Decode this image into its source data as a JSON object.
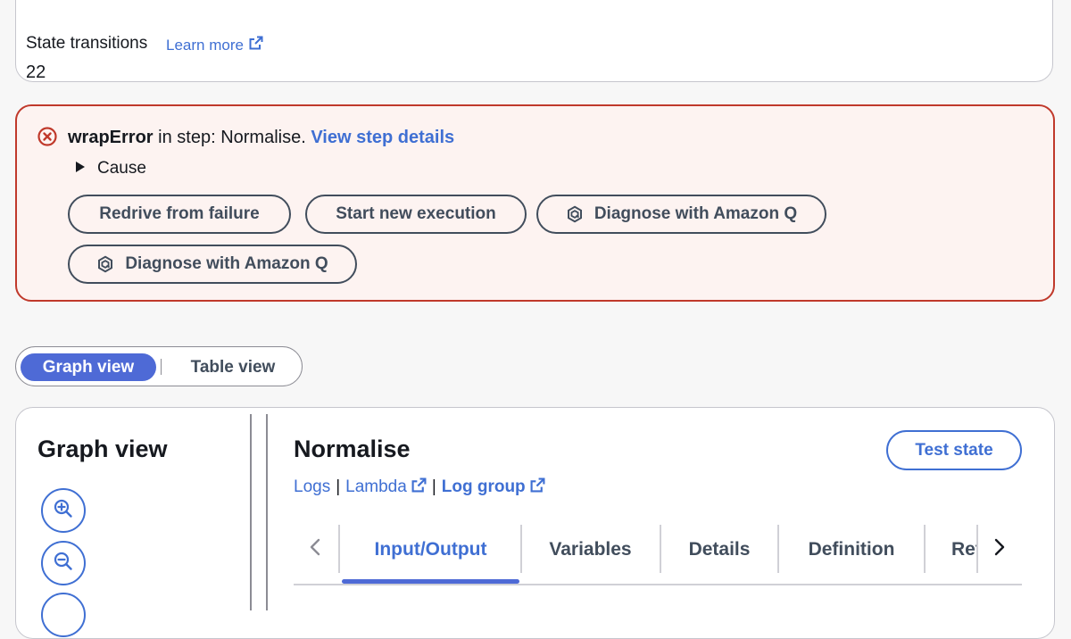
{
  "summary": {
    "state_transitions_label": "State transitions",
    "learn_more_label": "Learn more",
    "state_transitions_value": "22"
  },
  "alert": {
    "error_name": "wrapError",
    "message_middle": " in step: Normalise. ",
    "view_details_link": "View step details",
    "cause_label": "Cause",
    "buttons": {
      "redrive": "Redrive from failure",
      "start_new": "Start new execution",
      "diagnose_1": "Diagnose with Amazon Q",
      "diagnose_2": "Diagnose with Amazon Q"
    },
    "colors": {
      "border": "#c0392b",
      "background": "#fdf3f1"
    }
  },
  "view_toggle": {
    "graph_view": "Graph view",
    "table_view": "Table view",
    "selected": "Graph view"
  },
  "graph_panel": {
    "title": "Graph view"
  },
  "state_panel": {
    "title": "Normalise",
    "test_state_button": "Test state",
    "links": {
      "logs": "Logs",
      "lambda": "Lambda",
      "log_group": "Log group"
    },
    "tabs": {
      "input_output": "Input/Output",
      "variables": "Variables",
      "details": "Details",
      "definition": "Definition",
      "truncated": "Retry"
    },
    "active_tab": "Input/Output"
  },
  "theme": {
    "accent": "#4e6ad6",
    "link": "#3f6fd3",
    "text": "#16191f",
    "muted": "#414d5c"
  }
}
